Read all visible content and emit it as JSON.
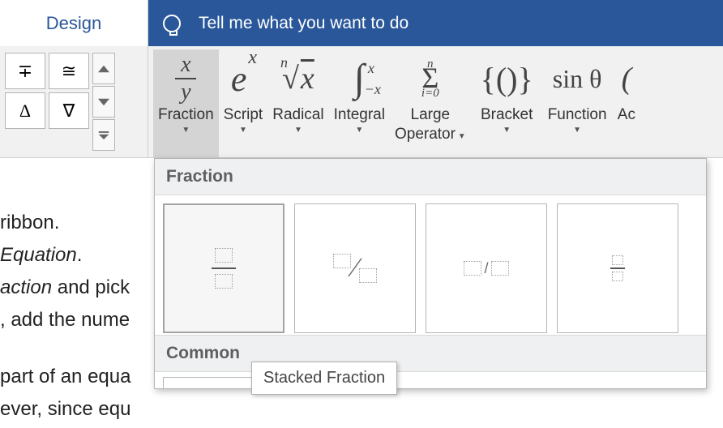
{
  "tabs": {
    "design": "Design"
  },
  "tellme": {
    "placeholder": "Tell me what you want to do"
  },
  "symbol_grid": {
    "top_left": "∓",
    "top_right": "≅",
    "bottom_left": "Δ",
    "bottom_right": "∇"
  },
  "structures": {
    "fraction": {
      "label": "Fraction",
      "glyph_top": "x",
      "glyph_bottom": "y"
    },
    "script": {
      "label": "Script",
      "glyph": "e",
      "sup": "x"
    },
    "radical": {
      "label": "Radical",
      "n": "n",
      "x": "x"
    },
    "integral": {
      "label": "Integral",
      "up": "x",
      "lo": "−x"
    },
    "large_op": {
      "label": "Large",
      "label2": "Operator",
      "n": "n",
      "i0": "i=0"
    },
    "bracket": {
      "label": "Bracket",
      "glyph": "{()}"
    },
    "function": {
      "label": "Function",
      "glyph": "sin θ"
    },
    "accent": {
      "label": "Ac"
    }
  },
  "dropdown": {
    "header1": "Fraction",
    "header2": "Common",
    "tooltip": "Stacked Fraction"
  },
  "doc": {
    "l1": "ribbon.",
    "l2a": "Equation",
    "l2b": ".",
    "l3a": "action",
    "l3b": " and pick ",
    "l4": ", add the nume",
    "l5": "part of an equa",
    "l6": "ever, since equ"
  }
}
